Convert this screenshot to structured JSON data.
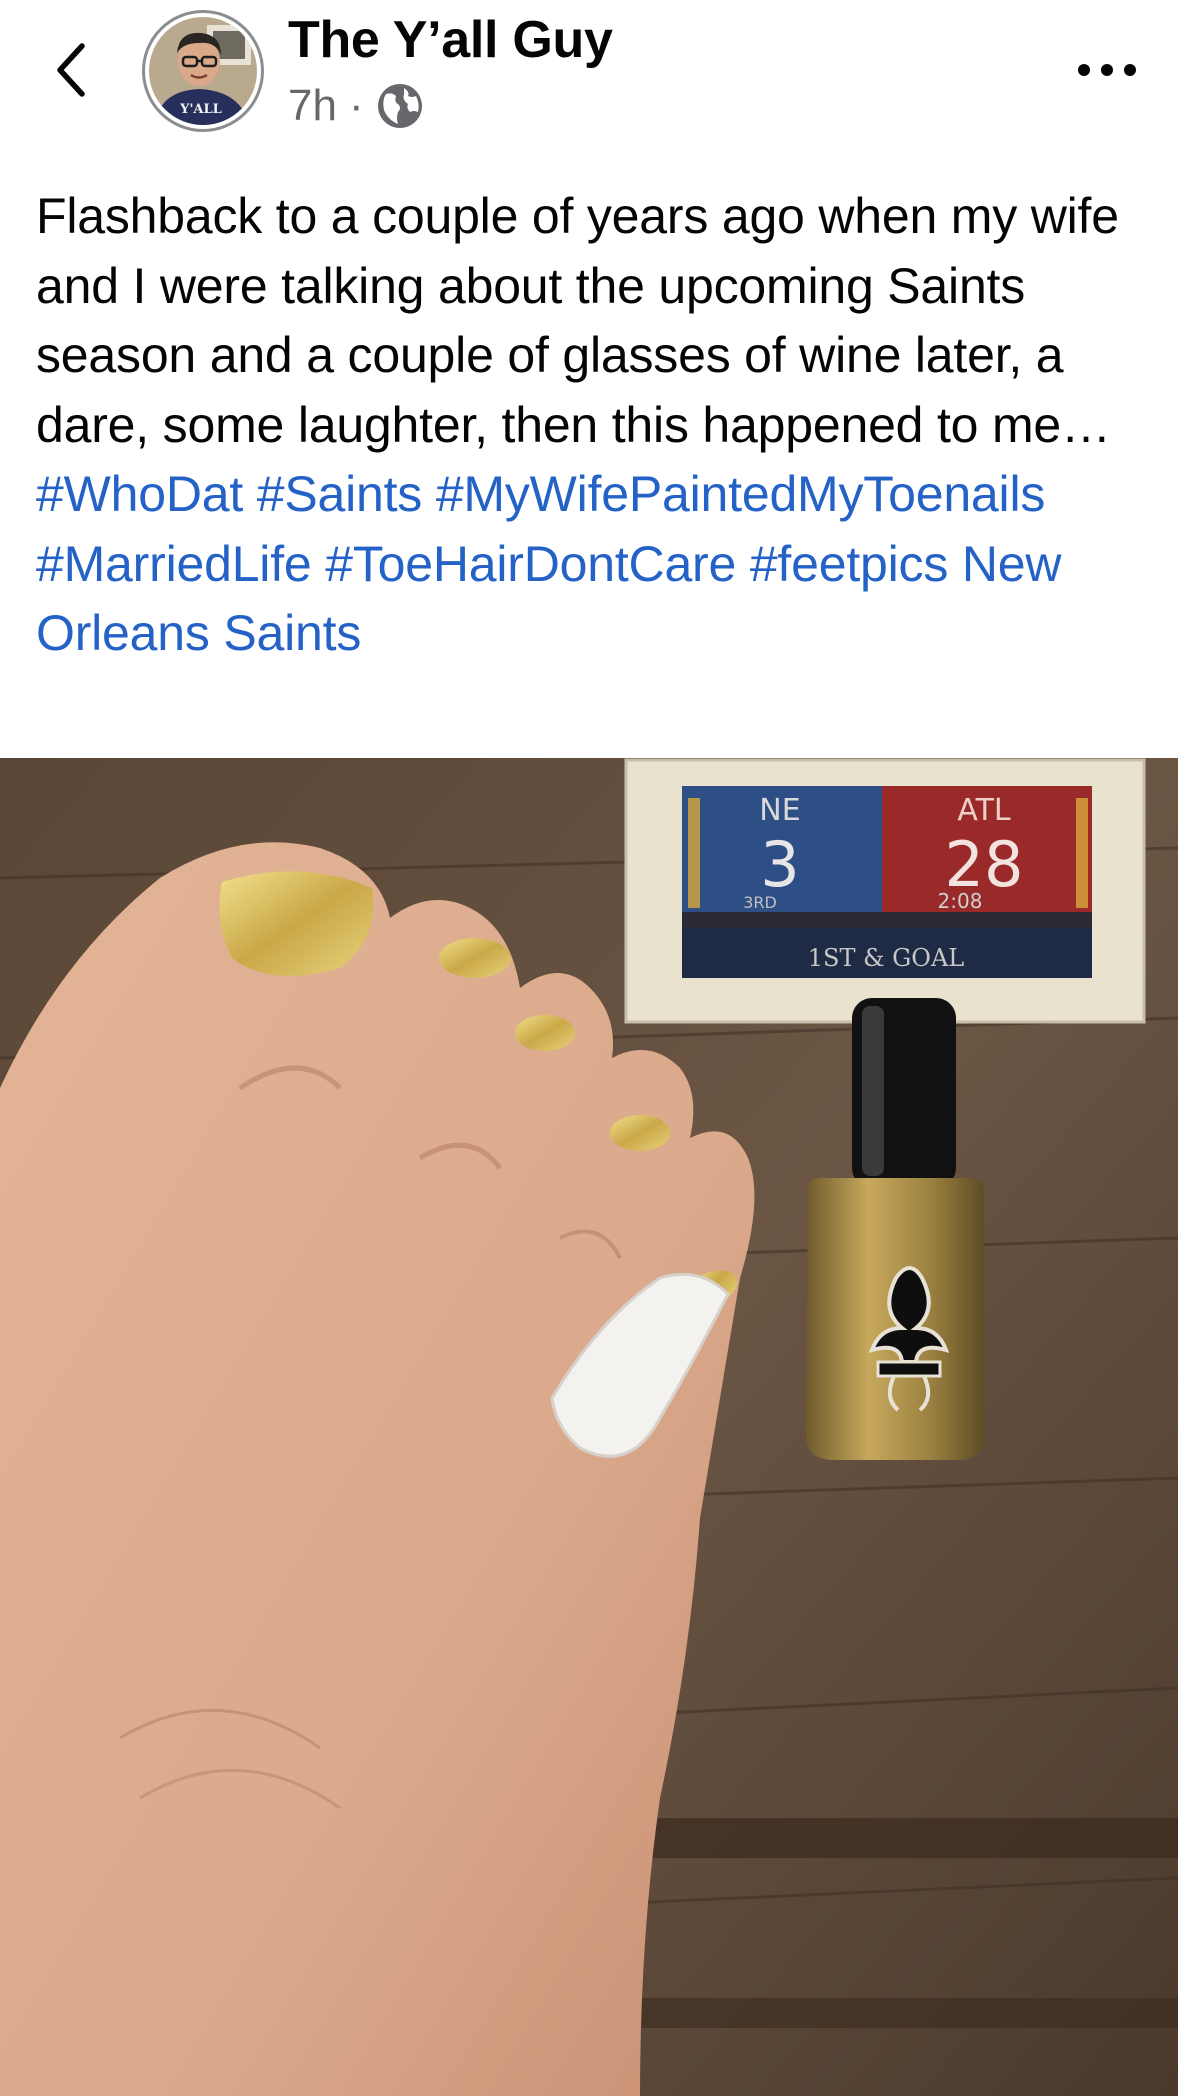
{
  "header": {
    "author_name": "The Y’all Guy",
    "time": "7h",
    "separator": "·",
    "privacy_icon": "globe-icon",
    "back_icon": "chevron-left-icon",
    "more_icon": "more-horizontal-icon",
    "avatar_shirt_text": "Y'ALL"
  },
  "post": {
    "text": "Flashback to a couple of years ago when my wife and I were talking about the upcoming Saints season and a couple of glasses of wine later, a dare, some laughter, then this happened to me…",
    "hashtags": [
      "#WhoDat",
      "#Saints",
      "#MyWifePaintedMyToenails",
      "#MarriedLife",
      "#ToeHairDontCare",
      "#feetpics"
    ],
    "page_mention": "New Orleans Saints"
  },
  "photo": {
    "coaster": {
      "team_left": "NE",
      "score_left": "3",
      "team_right": "ATL",
      "score_right": "28",
      "quarter": "3RD",
      "clock": "2:08",
      "down": "1ST & GOAL"
    }
  },
  "colors": {
    "link": "#2462c7",
    "meta_gray": "#65676b",
    "text": "#050505"
  }
}
